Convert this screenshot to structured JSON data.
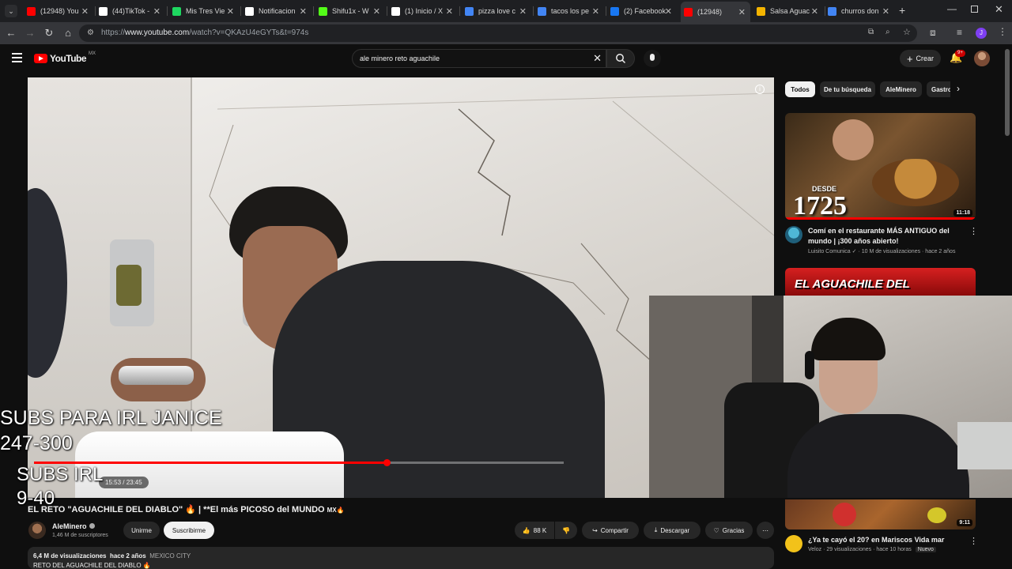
{
  "tabs": [
    {
      "label": "(12948) You",
      "color": "#ff0000"
    },
    {
      "label": "(44)TikTok -",
      "color": "#ffffff"
    },
    {
      "label": "Mis Tres Vie",
      "color": "#1ed760"
    },
    {
      "label": "Notificacion",
      "color": "#ffffff"
    },
    {
      "label": "Shifu1x - W",
      "color": "#53fc18"
    },
    {
      "label": "(1) Inicio / X",
      "color": "#ffffff"
    },
    {
      "label": "pizza love c",
      "color": "#4285f4"
    },
    {
      "label": "tacos los pe",
      "color": "#4285f4"
    },
    {
      "label": "(2) Facebook",
      "color": "#1877f2"
    },
    {
      "label": "(12948)",
      "color": "#ff0000"
    },
    {
      "label": "Salsa Aguac",
      "color": "#f4b400"
    },
    {
      "label": "churros don",
      "color": "#4285f4"
    }
  ],
  "address": {
    "prefix": "https://",
    "host": "www.youtube.com",
    "path": "/watch?v=QKAzU4eGYTs&t=974s"
  },
  "youtube": {
    "logo_text": "YouTube",
    "region": "MX",
    "search_value": "ale minero reto aguachile",
    "create_label": "Crear",
    "notif_count": "9+"
  },
  "player": {
    "time": "15:53 / 23:45",
    "progress": 0.665
  },
  "overlay": {
    "line1": "SUBS PARA IRL JANICE",
    "line2": "247-300",
    "line3": "SUBS IRL",
    "line4": "9-40"
  },
  "video": {
    "title": "EL RETO \"AGUACHILE DEL DIABLO\" 🔥 | **El más PICOSO del MUNDO",
    "title_suffix": "MX🔥",
    "channel": "AleMinero",
    "subscribers": "1,46 M de suscriptores",
    "join_label": "Unirme",
    "subscribe_label": "Suscribirme",
    "likes": "88 K",
    "share_label": "Compartir",
    "download_label": "Descargar",
    "thanks_label": "Gracias",
    "views": "6,4 M de visualizaciones",
    "age": "hace 2 años",
    "location": "MEXICO CITY",
    "desc_start": "RETO DEL AGUACHILE DEL DIABLO 🔥"
  },
  "chips": [
    "Todos",
    "De tu búsqueda",
    "AleMinero",
    "Gastro"
  ],
  "recommended": [
    {
      "overlay_small": "DESDE",
      "overlay_big": "1725",
      "duration": "11:18",
      "title": "Comí en el restaurante MÁS ANTIGUO del mundo | ¡300 años abierto!",
      "channel": "Luisito Comunica",
      "meta": "10 M de visualizaciones · hace 2 años"
    },
    {
      "overlay_big": "EL AGUACHILE DEL"
    },
    {
      "duration": "9:11",
      "title": "¿Ya te cayó el 20? en Mariscos Vida mar",
      "channel": "Veloz",
      "meta": "29 visualizaciones · hace 10 horas",
      "badge": "Nuevo"
    }
  ]
}
